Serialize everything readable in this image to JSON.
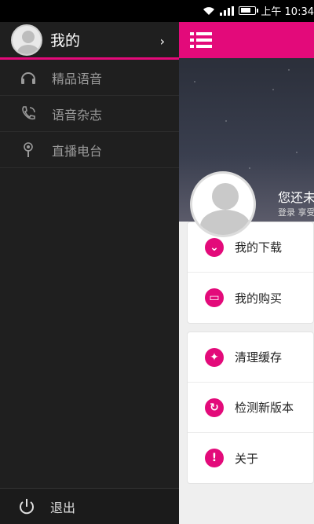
{
  "status": {
    "time": "上午 10:34"
  },
  "drawer": {
    "title": "我的",
    "items": [
      {
        "label": "精品语音",
        "icon": "headphones-icon"
      },
      {
        "label": "语音杂志",
        "icon": "phone-icon"
      },
      {
        "label": "直播电台",
        "icon": "radio-tower-icon"
      }
    ],
    "logout": {
      "label": "退出",
      "icon": "power-icon"
    }
  },
  "main": {
    "hero": {
      "name": "您还未",
      "subtitle": "登录 享受"
    },
    "group1": [
      {
        "label": "我的下载",
        "icon": "download-icon"
      },
      {
        "label": "我的购买",
        "icon": "purchase-icon"
      }
    ],
    "group2": [
      {
        "label": "清理缓存",
        "icon": "clean-icon"
      },
      {
        "label": "检测新版本",
        "icon": "update-icon"
      },
      {
        "label": "关于",
        "icon": "info-icon"
      }
    ]
  },
  "colors": {
    "accent": "#e30a7a",
    "drawer_bg": "#1f1f1f"
  }
}
